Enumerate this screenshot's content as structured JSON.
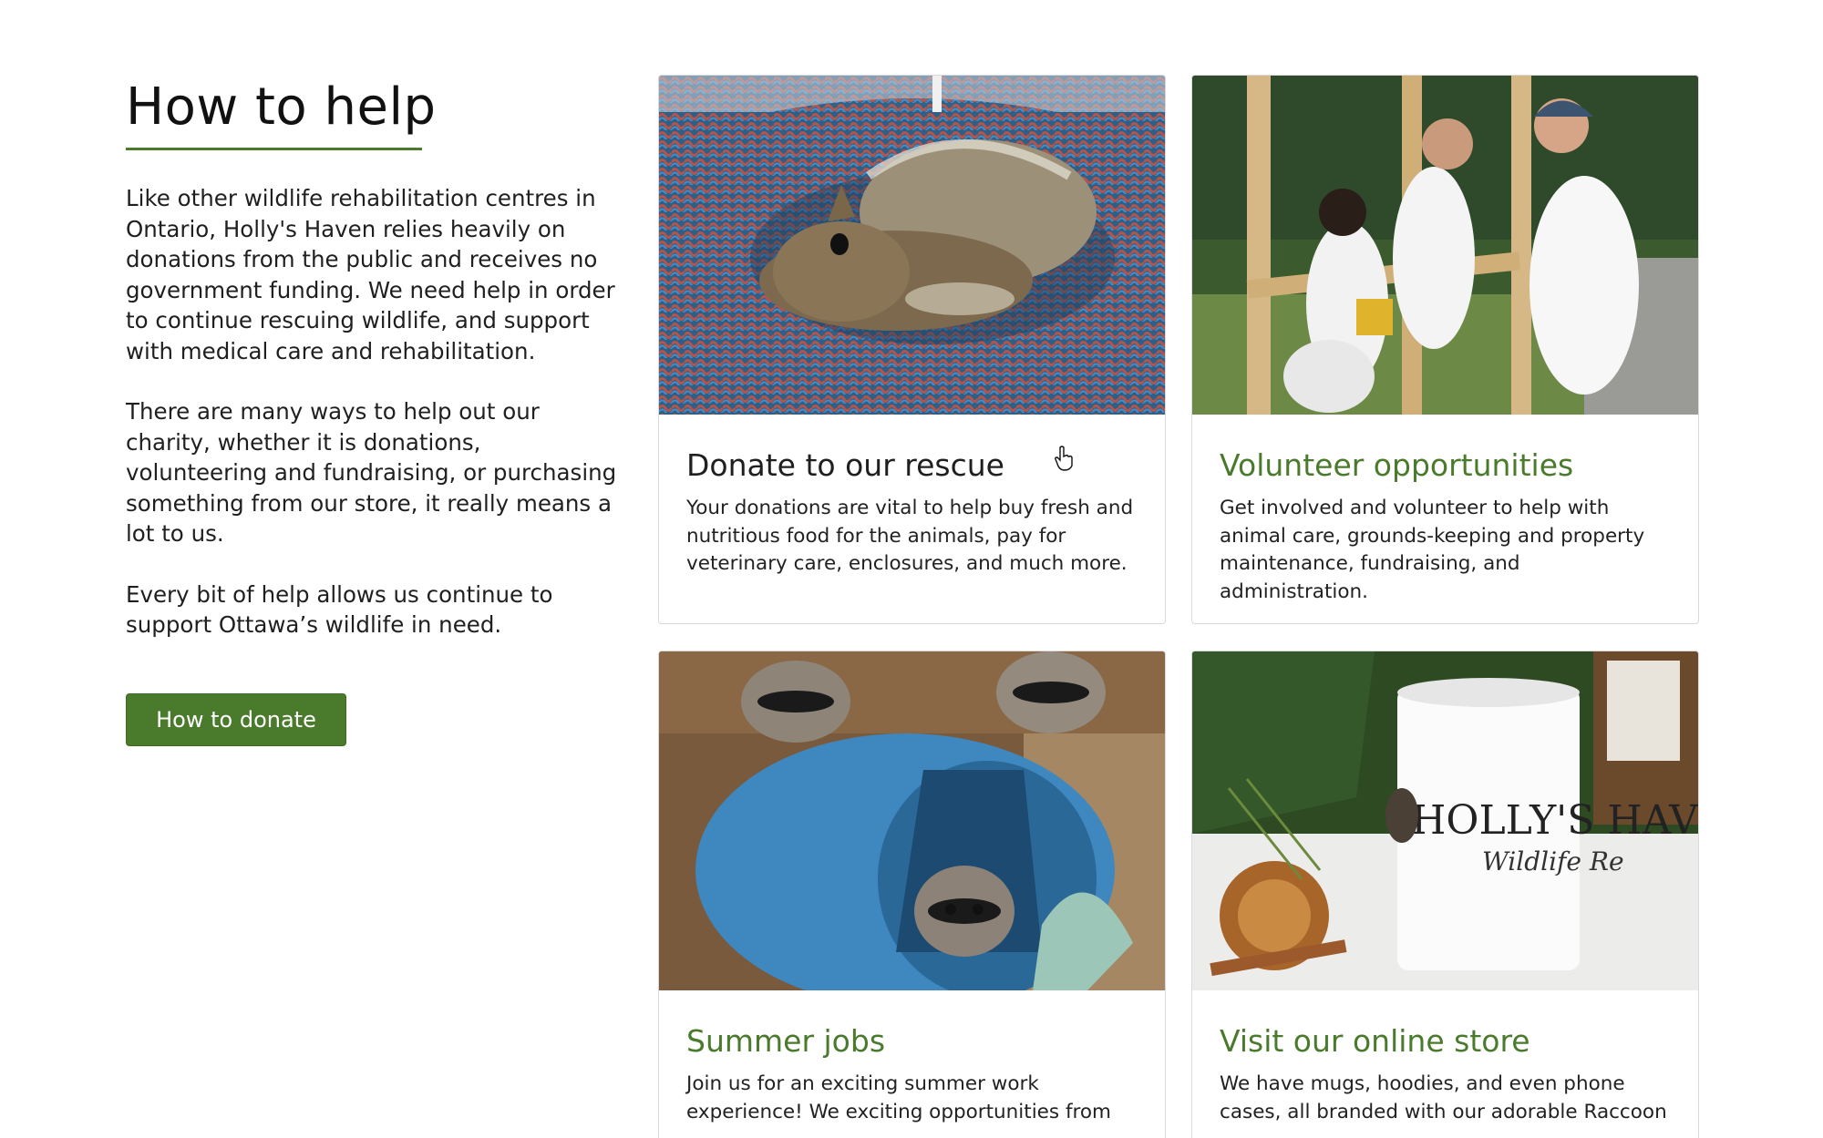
{
  "intro": {
    "title": "How to help",
    "paragraphs": [
      "Like other wildlife rehabilitation centres in Ontario, Holly's Haven relies heavily on donations from the public and receives no government funding. We need help in order to continue rescuing wildlife, and support with medical care and rehabilitation.",
      "There are many ways to help out our charity, whether it is donations, volunteering and fundraising, or purchasing something from our store, it really means a lot to us.",
      "Every bit of help allows us continue to support Ottawa’s wildlife in need."
    ],
    "button_label": "How to donate"
  },
  "cards": [
    {
      "heading": "Donate to our rescue",
      "description": "Your donations are vital to help buy fresh and nutritious food for the animals, pay for veterinary care, enclosures, and much more.",
      "image": "squirrel-in-knitted-basket"
    },
    {
      "heading": "Volunteer opportunities",
      "description": "Get involved and volunteer to help with animal care, grounds-keeping and property maintenance, fundraising, and administration.",
      "image": "volunteers-building-enclosure"
    },
    {
      "heading": "Summer jobs",
      "description": "Join us for an exciting summer work experience! We exciting opportunities from",
      "image": "raccoons-in-blue-barrel"
    },
    {
      "heading": "Visit our online store",
      "description": "We have mugs, hoodies, and even phone cases, all branded with our adorable Raccoon",
      "image": "branded-mug"
    }
  ],
  "mug_text": {
    "line1": "HOLLY'S HAV",
    "line2": "Wildlife Re"
  },
  "colors": {
    "accent_green": "#4a7a2c",
    "card_border": "#d9d9d9",
    "text": "#1f1f1f"
  }
}
